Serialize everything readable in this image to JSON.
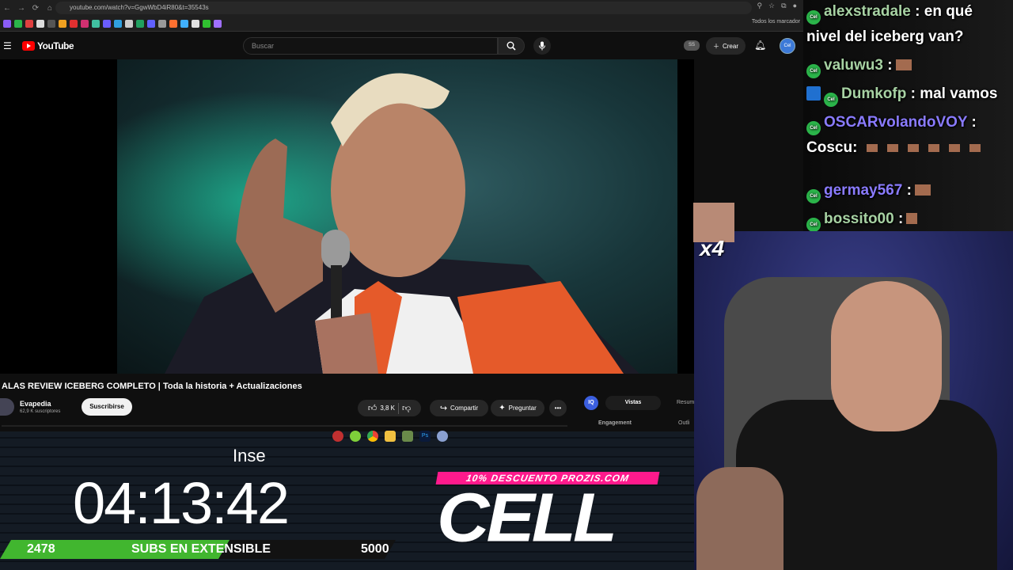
{
  "browser": {
    "url": "youtube.com/watch?v=GgwWbD4iR80&t=35543s",
    "bookmarks_all": "Todos los marcador"
  },
  "youtube": {
    "logo_text": "YouTube",
    "search_placeholder": "Buscar",
    "ss_badge": "SS",
    "create_label": "Crear",
    "avatar_text": "Cel"
  },
  "video": {
    "title": "ALAS REVIEW ICEBERG COMPLETO | Toda la historia + Actualizaciones",
    "channel_name": "Evapedia",
    "channel_subs": "62,9 K suscriptores",
    "subscribe_label": "Suscribirse",
    "likes": "3,8 K",
    "share_label": "Compartir",
    "ask_label": "Preguntar",
    "more_label": "•••"
  },
  "extension": {
    "iq_label": "IQ",
    "tab_views": "Vistas",
    "tab_summary": "Resum",
    "engagement_label": "Engagement",
    "outline_label": "Outli"
  },
  "stream": {
    "inse_text": "Inse",
    "timer": "04:13:42",
    "subs_current": "2478",
    "subs_label": "SUBS EN EXTENSIBLE",
    "subs_goal": "5000",
    "subs_progress": 0.4956,
    "promo_text": "10% DESCUENTO PROZIS.COM",
    "sponsor_text": "CELL",
    "emote_multiplier": "x4"
  },
  "chat": {
    "messages": [
      {
        "user": "alexstradale",
        "text": ": en qué"
      },
      {
        "user": "",
        "text": "nivel del iceberg van?"
      },
      {
        "user": "valuwu3",
        "text": ":"
      },
      {
        "user": "Dumkofp",
        "text": ": mal vamos"
      },
      {
        "user": "OSCARvolandoVOY",
        "text": ":"
      },
      {
        "user": "",
        "text": "Coscu:"
      },
      {
        "user": "germay567",
        "text": ":"
      },
      {
        "user": "bossito00",
        "text": ":"
      }
    ]
  },
  "colors": {
    "youtube_red": "#ff0000",
    "chat_badge": "#2bb44a",
    "subs_bar": "#41b62f",
    "promo_pink": "#ff1a8c"
  }
}
